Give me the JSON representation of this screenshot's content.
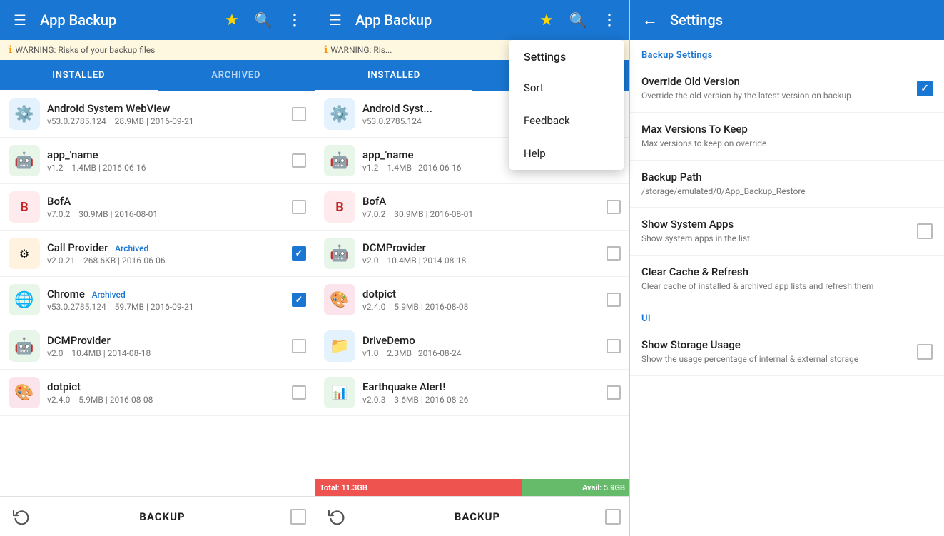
{
  "panel1": {
    "topbar": {
      "title": "App Backup",
      "menu_icon": "☰",
      "star_icon": "★",
      "search_icon": "⌕",
      "more_icon": "⋮"
    },
    "warning": "WARNING: Risks of your backup files",
    "tabs": [
      {
        "label": "INSTALLED",
        "active": true
      },
      {
        "label": "ARCHIVED",
        "active": false
      }
    ],
    "apps": [
      {
        "name": "Android System WebView",
        "version": "v53.0.2785.124",
        "size": "28.9MB",
        "date": "2016-09-21",
        "checked": false,
        "badge": "",
        "icon": "⚙"
      },
      {
        "name": "app_'name",
        "version": "v1.2",
        "size": "1.4MB",
        "date": "2016-06-16",
        "checked": false,
        "badge": "",
        "icon": "🤖"
      },
      {
        "name": "BofA",
        "version": "v7.0.2",
        "size": "30.9MB",
        "date": "2016-08-01",
        "checked": false,
        "badge": "",
        "icon": "🏦"
      },
      {
        "name": "Call Provider",
        "version": "v2.0.21",
        "size": "268.6KB",
        "date": "2016-06-06",
        "checked": true,
        "badge": "Archived",
        "icon": "⚙"
      },
      {
        "name": "Chrome",
        "version": "v53.0.2785.124",
        "size": "59.7MB",
        "date": "2016-09-21",
        "checked": true,
        "badge": "Archived",
        "icon": "🌐"
      },
      {
        "name": "DCMProvider",
        "version": "v2.0",
        "size": "10.4MB",
        "date": "2014-08-18",
        "checked": false,
        "badge": "",
        "icon": "🤖"
      },
      {
        "name": "dotpict",
        "version": "v2.4.0",
        "size": "5.9MB",
        "date": "2016-08-08",
        "checked": false,
        "badge": "",
        "icon": "🎨"
      }
    ],
    "bottom": {
      "backup_label": "BACKUP"
    }
  },
  "panel2": {
    "topbar": {
      "title": "App Backup",
      "menu_icon": "☰"
    },
    "warning": "WARNING: Ris...",
    "tabs": [
      {
        "label": "INSTALLED",
        "active": true
      }
    ],
    "dropdown": {
      "header": "Settings",
      "items": [
        {
          "label": "Sort"
        },
        {
          "label": "Feedback"
        },
        {
          "label": "Help"
        }
      ]
    },
    "apps": [
      {
        "name": "Android Syst...",
        "version": "v53.0.2785.124",
        "size": "",
        "date": "",
        "checked": false,
        "badge": "",
        "icon": "⚙"
      },
      {
        "name": "app_'name",
        "version": "v1.2",
        "size": "1.4MB",
        "date": "2016-06-16",
        "checked": false,
        "badge": "",
        "icon": "🤖"
      },
      {
        "name": "BofA",
        "version": "v7.0.2",
        "size": "30.9MB",
        "date": "2016-08-01",
        "checked": false,
        "badge": "",
        "icon": "🏦"
      },
      {
        "name": "DCMProvider",
        "version": "v2.0",
        "size": "10.4MB",
        "date": "2014-08-18",
        "checked": false,
        "badge": "",
        "icon": "🤖"
      },
      {
        "name": "dotpict",
        "version": "v2.4.0",
        "size": "5.9MB",
        "date": "2016-08-08",
        "checked": false,
        "badge": "",
        "icon": "🎨"
      },
      {
        "name": "DriveDemo",
        "version": "v1.0",
        "size": "2.3MB",
        "date": "2016-08-24",
        "checked": false,
        "badge": "",
        "icon": "📁"
      },
      {
        "name": "Earthquake Alert!",
        "version": "v2.0.3",
        "size": "3.6MB",
        "date": "2016-08-26",
        "checked": false,
        "badge": "",
        "icon": "📊"
      }
    ],
    "storage": {
      "used_label": "Total: 11.3GB",
      "avail_label": "Avail: 5.9GB",
      "used_pct": 66
    },
    "bottom": {
      "backup_label": "BACKUP"
    }
  },
  "panel3": {
    "topbar": {
      "title": "Settings",
      "back_icon": "←"
    },
    "sections": [
      {
        "label": "Backup Settings",
        "items": [
          {
            "title": "Override Old Version",
            "desc": "Override the old version by the latest version on backup",
            "type": "checkbox",
            "checked": true
          },
          {
            "title": "Max Versions To Keep",
            "desc": "Max versions to keep on override",
            "type": "none"
          },
          {
            "title": "Backup Path",
            "desc": "/storage/emulated/0/App_Backup_Restore",
            "type": "none"
          },
          {
            "title": "Show System Apps",
            "desc": "Show system apps in the list",
            "type": "checkbox",
            "checked": false
          },
          {
            "title": "Clear Cache & Refresh",
            "desc": "Clear cache of installed & archived app lists and refresh them",
            "type": "none"
          }
        ]
      },
      {
        "label": "UI",
        "items": [
          {
            "title": "Show Storage Usage",
            "desc": "Show the usage percentage of internal & external storage",
            "type": "checkbox",
            "checked": false
          }
        ]
      }
    ]
  }
}
